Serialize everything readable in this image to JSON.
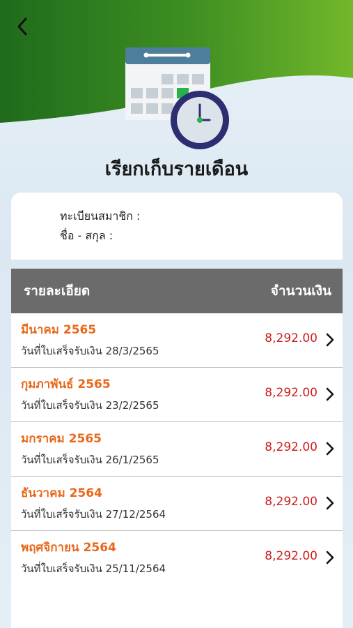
{
  "header": {
    "title": "เรียกเก็บรายเดือน",
    "back_icon": "chevron-left-icon",
    "hero_icon": "calendar-clock-icon"
  },
  "member": {
    "registration_label": "ทะเบียนสมาชิก :",
    "name_label": "ชื่อ - สกุล :"
  },
  "table": {
    "col_detail": "รายละเอียด",
    "col_amount": "จำนวนเงิน",
    "rows": [
      {
        "month": "มีนาคม 2565",
        "date": "วันที่ใบเสร็จรับเงิน 28/3/2565",
        "amount": "8,292.00"
      },
      {
        "month": "กุมภาพันธ์ 2565",
        "date": "วันที่ใบเสร็จรับเงิน 23/2/2565",
        "amount": "8,292.00"
      },
      {
        "month": "มกราคม 2565",
        "date": "วันที่ใบเสร็จรับเงิน 26/1/2565",
        "amount": "8,292.00"
      },
      {
        "month": "ธันวาคม 2564",
        "date": "วันที่ใบเสร็จรับเงิน 27/12/2564",
        "amount": "8,292.00"
      },
      {
        "month": "พฤศจิกายน 2564",
        "date": "วันที่ใบเสร็จรับเงิน 25/11/2564",
        "amount": "8,292.00"
      }
    ]
  },
  "colors": {
    "header_green_dark": "#1f6b1c",
    "header_green_light": "#6db52a",
    "month_orange": "#e8681a",
    "amount_red": "#cc1d1d",
    "table_head_gray": "#6b6b6b"
  }
}
